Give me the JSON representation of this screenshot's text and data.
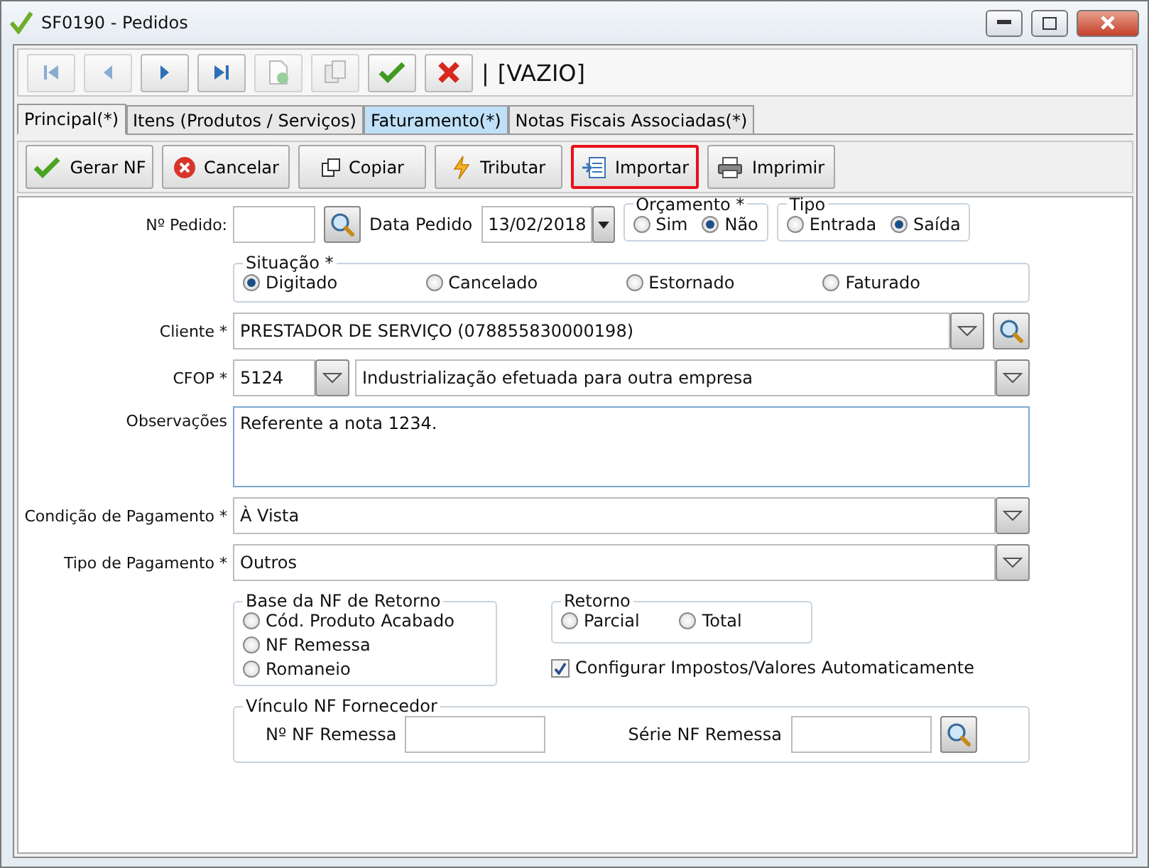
{
  "window": {
    "title": "SF0190 - Pedidos"
  },
  "toolbar": {
    "buttons": [
      {
        "kind": "first",
        "disabled": true
      },
      {
        "kind": "previous",
        "disabled": true
      },
      {
        "kind": "next",
        "disabled": false
      },
      {
        "kind": "last",
        "disabled": false
      },
      {
        "kind": "new",
        "disabled": true
      },
      {
        "kind": "copy",
        "disabled": true
      },
      {
        "kind": "confirm",
        "disabled": false
      },
      {
        "kind": "cancel",
        "disabled": false
      }
    ],
    "separator": "|",
    "record": "[VAZIO]"
  },
  "tabs": [
    {
      "label": "Principal(*)",
      "selected": true,
      "highlighted": false
    },
    {
      "label": "Itens (Produtos / Serviços)",
      "selected": false,
      "highlighted": false
    },
    {
      "label": "Faturamento(*)",
      "selected": false,
      "highlighted": true
    },
    {
      "label": "Notas Fiscais Associadas(*)",
      "selected": false,
      "highlighted": false
    }
  ],
  "actions": [
    {
      "label": "Gerar NF",
      "kind": "check",
      "focused": false
    },
    {
      "label": "Cancelar",
      "kind": "cancel",
      "focused": false
    },
    {
      "label": "Copiar",
      "kind": "copy",
      "focused": false
    },
    {
      "label": "Tributar",
      "kind": "bolt",
      "focused": false
    },
    {
      "label": "Importar",
      "kind": "import",
      "focused": true
    },
    {
      "label": "Imprimir",
      "kind": "print",
      "focused": false
    }
  ],
  "form": {
    "pedido": {
      "label": "Nº Pedido:"
    },
    "data_pedido": {
      "label": "Data Pedido",
      "value": "13/02/2018"
    },
    "orcamento": {
      "legend": "Orçamento *",
      "options": [
        {
          "label": "Sim",
          "selected": false
        },
        {
          "label": "Não",
          "selected": true
        }
      ]
    },
    "tipo": {
      "legend": "Tipo",
      "options": [
        {
          "label": "Entrada",
          "selected": false
        },
        {
          "label": "Saída",
          "selected": true
        }
      ]
    },
    "situacao": {
      "legend": "Situação *",
      "options": [
        {
          "label": "Digitado",
          "selected": true
        },
        {
          "label": "Cancelado",
          "selected": false
        },
        {
          "label": "Estornado",
          "selected": false
        },
        {
          "label": "Faturado",
          "selected": false
        }
      ]
    },
    "cliente": {
      "label": "Cliente *",
      "value": "PRESTADOR DE SERVIÇO (078855830000198)"
    },
    "cfop": {
      "label": "CFOP *",
      "code": "5124",
      "description": "Industrialização efetuada para outra empresa"
    },
    "observacoes": {
      "label": "Observações",
      "value": "Referente a nota 1234."
    },
    "condicao_pagamento": {
      "label": "Condição de Pagamento *",
      "value": "À Vista"
    },
    "tipo_pagamento": {
      "label": "Tipo de Pagamento *",
      "value": "Outros"
    },
    "base_nf_retorno": {
      "legend": "Base da NF de Retorno",
      "options": [
        {
          "label": "Cód. Produto Acabado",
          "selected": false
        },
        {
          "label": "NF Remessa",
          "selected": false
        },
        {
          "label": "Romaneio",
          "selected": false
        }
      ]
    },
    "retorno": {
      "legend": "Retorno",
      "options": [
        {
          "label": "Parcial",
          "selected": false
        },
        {
          "label": "Total",
          "selected": false
        }
      ]
    },
    "auto_config": {
      "label": "Configurar Impostos/Valores Automaticamente",
      "checked": true
    },
    "vinculo": {
      "legend": "Vínculo NF Fornecedor",
      "fields": [
        {
          "label": "Nº NF Remessa"
        },
        {
          "label": "Série NF Remessa"
        }
      ]
    }
  }
}
